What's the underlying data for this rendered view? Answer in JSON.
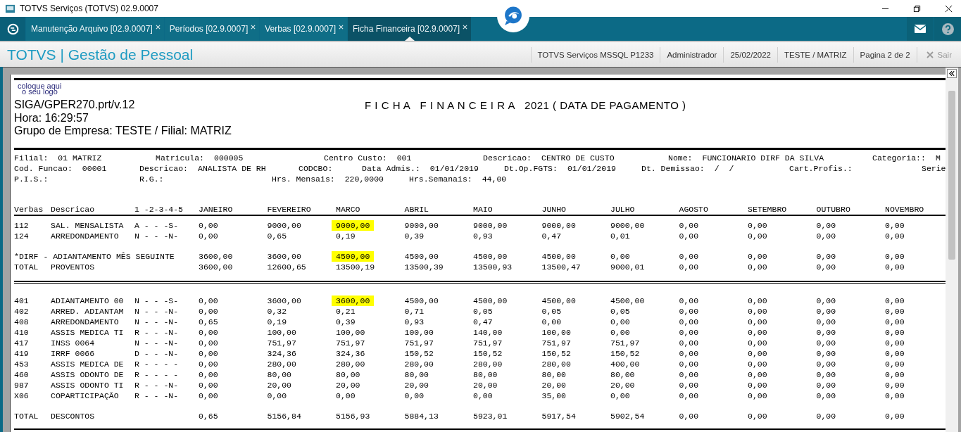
{
  "window": {
    "title": "TOTVS Serviços (TOTVS) 02.9.0007"
  },
  "tabs": [
    {
      "label": "Manutenção Arquivo [02.9.0007]",
      "selected": false
    },
    {
      "label": "Períodos [02.9.0007]",
      "selected": false
    },
    {
      "label": "Verbas [02.9.0007]",
      "selected": false
    },
    {
      "label": "Ficha Financeira [02.9.0007]",
      "selected": true
    }
  ],
  "header": {
    "app_title": "TOTVS | Gestão de Pessoal",
    "info": [
      "TOTVS Serviços MSSQL P1233",
      "Administrador",
      "25/02/2022",
      "TESTE / MATRIZ",
      "Pagina 2 de 2"
    ],
    "exit_button": {
      "label": "Sair",
      "disabled": true
    }
  },
  "report": {
    "logo_text": [
      "coloque aqui",
      "o seu logo"
    ],
    "program": "SIGA/GPER270.prt/v.12",
    "time": "Hora: 16:29:57",
    "group": "Grupo de Empresa: TESTE / Filial: MATRIZ",
    "title": "F I C H A   F I N A N C E I R A   2021 ( DATA DE PAGAMENTO )",
    "info_lines": [
      [
        {
          "label": "Filial:",
          "value": "01 MATRIZ"
        },
        {
          "label": "Matricula:",
          "value": "000005"
        },
        {
          "label": "Centro Custo:",
          "value": "001"
        },
        {
          "label": "Descricao:",
          "value": "CENTRO DE CUSTO"
        },
        {
          "label": "Nome:",
          "value": "FUNCIONARIO DIRF DA SILVA"
        },
        {
          "label": "Categoria::",
          "value": "M"
        }
      ],
      [
        {
          "label": "Cod. Funcao:",
          "value": "00001"
        },
        {
          "label": "Descricao:",
          "value": "ANALISTA DE RH"
        },
        {
          "label": "CODCBO:"
        },
        {
          "label": "Data Admis.:",
          "value": "01/01/2019"
        },
        {
          "label": "Dt.Op.FGTS:",
          "value": "01/01/2019"
        },
        {
          "label": "Dt. Demissao:",
          "value": "/  /"
        },
        {
          "label": "Cart.Profis.:"
        },
        {
          "label": "Serie"
        }
      ],
      [
        {
          "label": "P.I.S.:"
        },
        {
          "label": "R.G.:"
        },
        {
          "label": "Hrs. Mensais:",
          "value": "220,0000"
        },
        {
          "label": "Hrs.Semanais:",
          "value": "44,00"
        }
      ]
    ],
    "columns": [
      "Verbas",
      "Descricao",
      "1 -2-3-4-5",
      "JANEIRO",
      "FEVEREIRO",
      "MARCO",
      "ABRIL",
      "MAIO",
      "JUNHO",
      "JULHO",
      "AGOSTO",
      "SETEMBRO",
      "OUTUBRO",
      "NOVEMBRO"
    ],
    "sections": [
      {
        "rows": [
          {
            "kind": "verba",
            "code": "112",
            "description": "SAL. MENSALISTA",
            "flags": "A - - -S-",
            "values": [
              "0,00",
              "9000,00",
              "9000,00",
              "9000,00",
              "9000,00",
              "9000,00",
              "9000,00",
              "0,00",
              "0,00",
              "0,00",
              "0,00"
            ],
            "highlights": [
              false,
              false,
              true,
              false,
              false,
              false,
              false,
              false,
              false,
              false,
              false
            ]
          },
          {
            "kind": "verba",
            "code": "124",
            "description": "ARREDONDAMENTO",
            "flags": "N - - -N-",
            "values": [
              "0,00",
              "0,65",
              "0,19",
              "0,39",
              "0,93",
              "0,47",
              "0,01",
              "0,00",
              "0,00",
              "0,00",
              "0,00"
            ]
          }
        ]
      },
      {
        "double_rule_after": true,
        "rows": [
          {
            "kind": "note",
            "text": "*DIRF - ADIANTAMENTO MÊS SEGUINTE",
            "values": [
              "3600,00",
              "3600,00",
              "4500,00",
              "4500,00",
              "4500,00",
              "4500,00",
              "0,00",
              "0,00",
              "0,00",
              "0,00",
              "0,00"
            ],
            "highlights": [
              false,
              false,
              true,
              false,
              false,
              false,
              false,
              false,
              false,
              false,
              false
            ]
          },
          {
            "kind": "total",
            "code": "TOTAL",
            "description": "PROVENTOS",
            "values": [
              "3600,00",
              "12600,65",
              "13500,19",
              "13500,39",
              "13500,93",
              "13500,47",
              "9000,01",
              "0,00",
              "0,00",
              "0,00",
              "0,00"
            ]
          }
        ]
      },
      {
        "rows": [
          {
            "kind": "verba",
            "code": "401",
            "description": "ADIANTAMENTO 00",
            "flags": "N - - -S-",
            "values": [
              "0,00",
              "3600,00",
              "3600,00",
              "4500,00",
              "4500,00",
              "4500,00",
              "4500,00",
              "0,00",
              "0,00",
              "0,00",
              "0,00"
            ],
            "highlights": [
              false,
              false,
              true,
              false,
              false,
              false,
              false,
              false,
              false,
              false,
              false
            ]
          },
          {
            "kind": "verba",
            "code": "402",
            "description": "ARRED. ADIANTAM",
            "flags": "N - - -N-",
            "values": [
              "0,00",
              "0,32",
              "0,21",
              "0,71",
              "0,05",
              "0,05",
              "0,05",
              "0,00",
              "0,00",
              "0,00",
              "0,00"
            ]
          },
          {
            "kind": "verba",
            "code": "408",
            "description": "ARREDONDAMENTO",
            "flags": "N - - -N-",
            "values": [
              "0,65",
              "0,19",
              "0,39",
              "0,93",
              "0,47",
              "0,00",
              "0,00",
              "0,00",
              "0,00",
              "0,00",
              "0,00"
            ]
          },
          {
            "kind": "verba",
            "code": "410",
            "description": "ASSIS MEDICA TI",
            "flags": "R - - -N-",
            "values": [
              "0,00",
              "100,00",
              "100,00",
              "100,00",
              "140,00",
              "100,00",
              "0,00",
              "0,00",
              "0,00",
              "0,00",
              "0,00"
            ]
          },
          {
            "kind": "verba",
            "code": "417",
            "description": "INSS 0064",
            "flags": "N - - -N-",
            "values": [
              "0,00",
              "751,97",
              "751,97",
              "751,97",
              "751,97",
              "751,97",
              "751,97",
              "0,00",
              "0,00",
              "0,00",
              "0,00"
            ]
          },
          {
            "kind": "verba",
            "code": "419",
            "description": "IRRF 0066",
            "flags": "D - - -N-",
            "values": [
              "0,00",
              "324,36",
              "324,36",
              "150,52",
              "150,52",
              "150,52",
              "150,52",
              "0,00",
              "0,00",
              "0,00",
              "0,00"
            ]
          },
          {
            "kind": "verba",
            "code": "453",
            "description": "ASSIS MEDICA DE",
            "flags": "R - - - -",
            "values": [
              "0,00",
              "280,00",
              "280,00",
              "280,00",
              "280,00",
              "280,00",
              "400,00",
              "0,00",
              "0,00",
              "0,00",
              "0,00"
            ]
          },
          {
            "kind": "verba",
            "code": "460",
            "description": "ASSIS ODONTO DE",
            "flags": "R - - - -",
            "values": [
              "0,00",
              "80,00",
              "80,00",
              "80,00",
              "80,00",
              "80,00",
              "80,00",
              "0,00",
              "0,00",
              "0,00",
              "0,00"
            ]
          },
          {
            "kind": "verba",
            "code": "987",
            "description": "ASSIS ODONTO TI",
            "flags": "R - - -N-",
            "values": [
              "0,00",
              "20,00",
              "20,00",
              "20,00",
              "20,00",
              "20,00",
              "20,00",
              "0,00",
              "0,00",
              "0,00",
              "0,00"
            ]
          },
          {
            "kind": "verba",
            "code": "X06",
            "description": "COPARTICIPAÇÃO",
            "flags": "R - - -N-",
            "values": [
              "0,00",
              "0,00",
              "0,00",
              "0,00",
              "0,00",
              "35,00",
              "0,00",
              "0,00",
              "0,00",
              "0,00",
              "0,00"
            ]
          }
        ]
      },
      {
        "rule_after": true,
        "rows": [
          {
            "kind": "total",
            "code": "TOTAL",
            "description": "DESCONTOS",
            "values": [
              "0,65",
              "5156,84",
              "5156,93",
              "5884,13",
              "5923,01",
              "5917,54",
              "5902,54",
              "0,00",
              "0,00",
              "0,00",
              "0,00"
            ]
          }
        ]
      }
    ]
  }
}
